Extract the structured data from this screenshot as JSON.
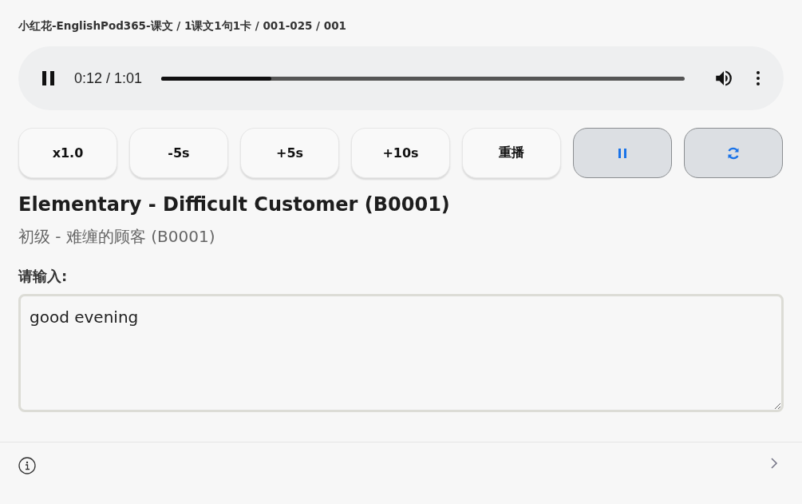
{
  "breadcrumb": "小红花-EnglishPod365-课文 / 1课文1句1卡 / 001-025 / 001",
  "player": {
    "playing": true,
    "time": "0:12 / 1:01",
    "level": 0.21
  },
  "buttons": [
    {
      "kind": "text",
      "label": "x1.0"
    },
    {
      "kind": "text",
      "label": "-5s"
    },
    {
      "kind": "text",
      "label": "+5s"
    },
    {
      "kind": "text",
      "label": "+10s"
    },
    {
      "kind": "text",
      "label": "重播"
    },
    {
      "kind": "pause"
    },
    {
      "kind": "repeat"
    }
  ],
  "title": "Elementary - Difficult Customer (B0001)",
  "subtitle": "初级 - 难缠的顾客 (B0001)",
  "input": {
    "label": "请输入:",
    "value": "good evening"
  }
}
